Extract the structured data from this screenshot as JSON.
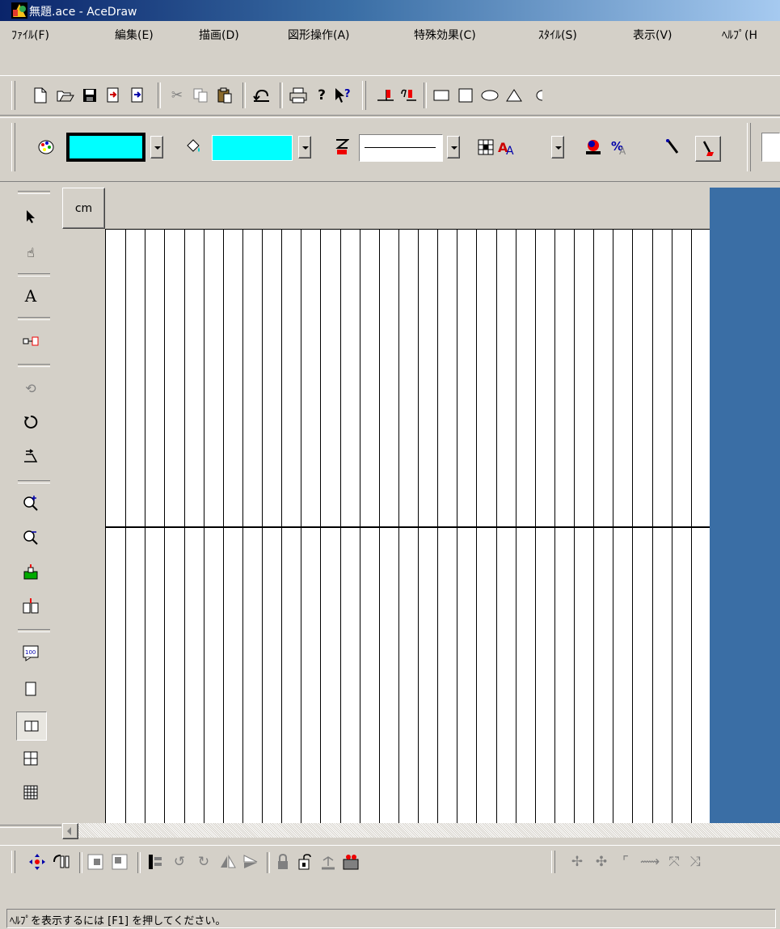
{
  "window": {
    "title": "無題.ace - AceDraw"
  },
  "menu": {
    "items": [
      "ﾌｧｲﾙ(F)",
      "編集(E)",
      "描画(D)",
      "図形操作(A)",
      "特殊効果(C)",
      "ｽﾀｲﾙ(S)",
      "表示(V)",
      "ﾍﾙﾌﾟ(H"
    ]
  },
  "style_toolbar": {
    "line_color": "#00ffff",
    "fill_color": "#00ffff"
  },
  "ruler": {
    "unit": "cm"
  },
  "canvas": {
    "page_color": "#ffffff",
    "desk_color": "#3a6ea5"
  },
  "status": {
    "text": "ﾍﾙﾌﾟを表示するには [F1] を押してください。"
  }
}
